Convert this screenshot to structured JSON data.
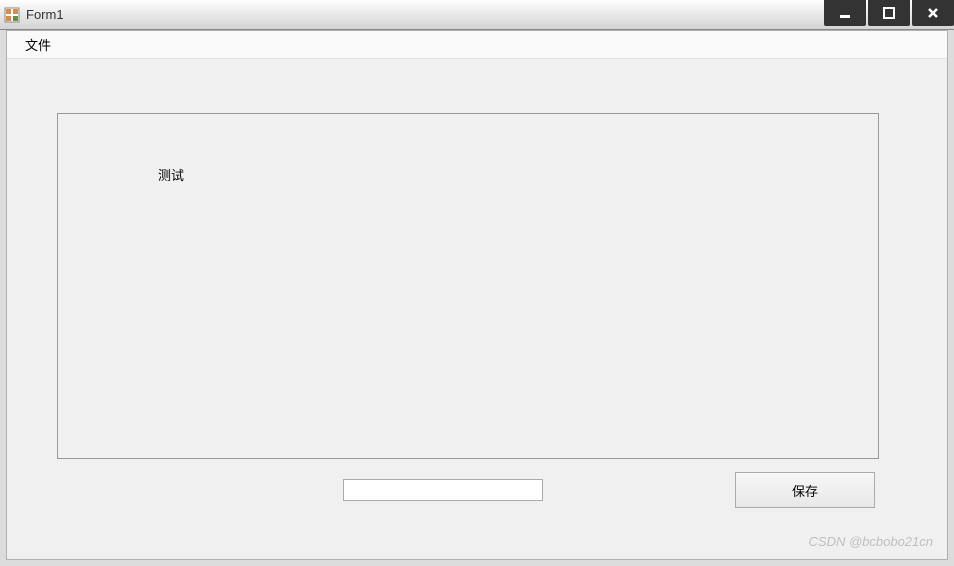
{
  "titlebar": {
    "title": "Form1"
  },
  "menubar": {
    "items": [
      {
        "label": "文件"
      }
    ]
  },
  "panel": {
    "label_text": "测试"
  },
  "textbox": {
    "value": ""
  },
  "buttons": {
    "save_label": "保存"
  },
  "watermark": {
    "text": "CSDN @bcbobo21cn"
  }
}
